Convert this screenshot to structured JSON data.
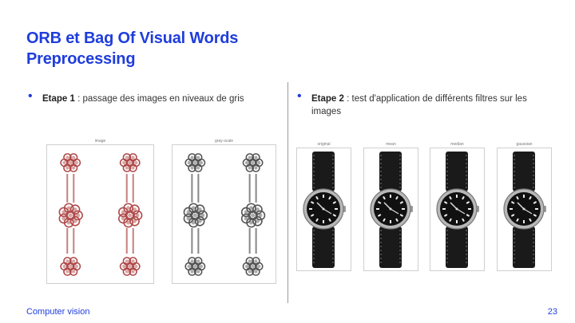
{
  "title": {
    "line1": "ORB et Bag Of Visual Words",
    "line2": "Preprocessing"
  },
  "left": {
    "bullet_label": "Etape 1",
    "bullet_text": " : passage des images en niveaux de gris",
    "panels": [
      {
        "label": "image",
        "tone": "#b04a4a"
      },
      {
        "label": "gray-scale",
        "tone": "#555555"
      }
    ]
  },
  "right": {
    "bullet_label": "Etape 2",
    "bullet_text": " : test d'application de différents filtres sur les images",
    "panels": [
      {
        "label": "original"
      },
      {
        "label": "mean"
      },
      {
        "label": "median"
      },
      {
        "label": "gaussian"
      }
    ]
  },
  "footer": {
    "left": "Computer vision",
    "page": "23"
  },
  "colors": {
    "accent": "#1f3ddc"
  }
}
